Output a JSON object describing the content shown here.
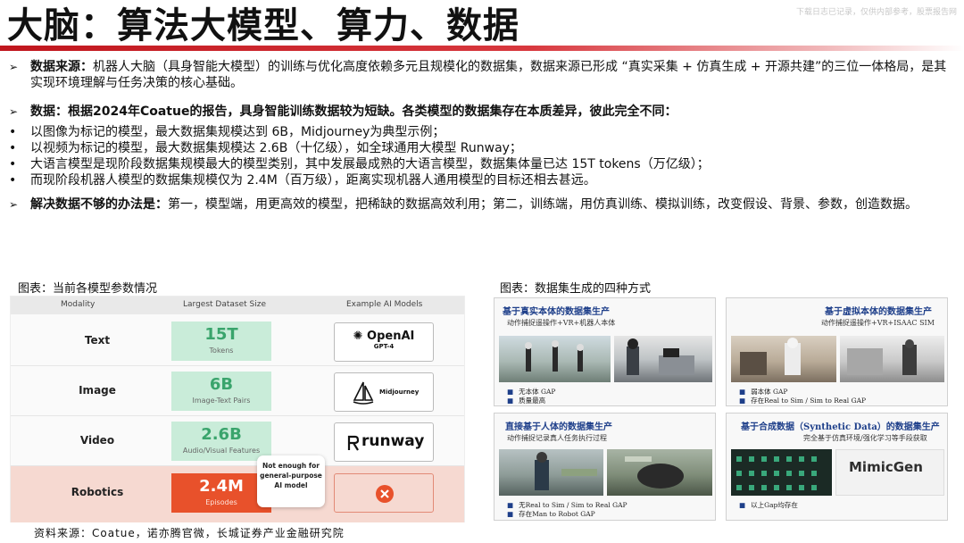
{
  "header": {
    "title": "大脑：算法大模型、算力、数据",
    "watermark": "下载日志已记录，仅供内部参考，股票报告网"
  },
  "body": {
    "p1_label": "数据来源：",
    "p1_text": "机器人大脑（具身智能大模型）的训练与优化高度依赖多元且规模化的数据集，数据来源已形成 “真实采集 + 仿真生成 + 开源共建”的三位一体格局，是其实现环境理解与任务决策的核心基础。",
    "p2_text": "数据：根据2024年Coatue的报告，具身智能训练数据较为短缺。各类模型的数据集存在本质差异，彼此完全不同：",
    "bullets": [
      "以图像为标记的模型，最大数据集规模达到 6B，Midjourney为典型示例；",
      "以视频为标记的模型，最大数据集规模达 2.6B（十亿级），如全球通用大模型 Runway；",
      "大语言模型是现阶段数据集规模最大的模型类别，其中发展最成熟的大语言模型，数据集体量已达 15T tokens（万亿级）；",
      "而现阶段机器人模型的数据集规模仅为 2.4M（百万级），距离实现机器人通用模型的目标还相去甚远。"
    ],
    "p3_label": "解决数据不够的办法是：",
    "p3_text": "第一，模型端，用更高效的模型，把稀缺的数据高效利用；第二，训练端，用仿真训练、模拟训练，改变假设、背景、参数，创造数据。"
  },
  "figure_left": {
    "caption": "图表：当前各模型参数情况",
    "headers": [
      "Modality",
      "Largest Dataset Size",
      "Example AI Models"
    ],
    "rows": [
      {
        "modality": "Text",
        "size": "15T",
        "unit": "Tokens",
        "model": "OpenAI",
        "model_sub": "GPT-4"
      },
      {
        "modality": "Image",
        "size": "6B",
        "unit": "Image-Text Pairs",
        "model": "Midjourney"
      },
      {
        "modality": "Video",
        "size": "2.6B",
        "unit": "Audio/Visual Features",
        "model": "runway"
      },
      {
        "modality": "Robotics",
        "size": "2.4M",
        "unit": "Episodes"
      }
    ],
    "callout": "Not enough for general-purpose AI model"
  },
  "figure_right": {
    "caption": "图表：数据集生成的四种方式",
    "panels": [
      {
        "title": "基于真实本体的数据集生产",
        "subtitle": "动作捕捉遥操作+VR+机器人本体",
        "notes": [
          "无本体 GAP",
          "质量最高"
        ]
      },
      {
        "title": "基于虚拟本体的数据集生产",
        "subtitle": "动作捕捉遥操作+VR+ISAAC SIM",
        "notes": [
          "弱本体 GAP",
          "存在Real to Sim / Sim to Real GAP"
        ]
      },
      {
        "title": "直接基于人体的数据集生产",
        "subtitle": "动作捕捉记录真人任务执行过程",
        "notes": [
          "无Real to Sim / Sim to Real GAP",
          "存在Man to Robot GAP"
        ]
      },
      {
        "title": "基于合成数据（Synthetic Data）的数据集生产",
        "subtitle": "完全基于仿真环境/强化学习等手段获取",
        "notes": [
          "以上Gap均存在"
        ]
      }
    ],
    "mimicgen_logo": "MimicGen"
  },
  "source": "资料来源：Coatue，诺亦腾官微，长城证券产业金融研究院"
}
